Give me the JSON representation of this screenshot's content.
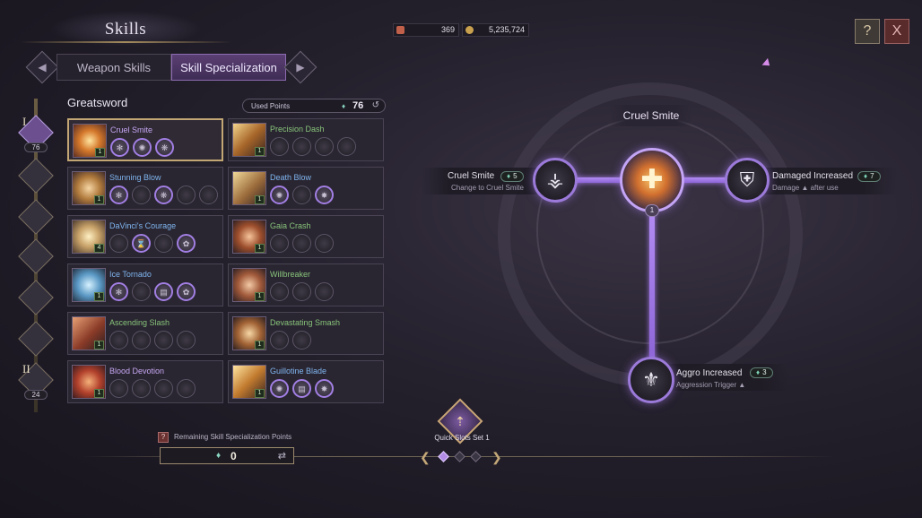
{
  "header": {
    "title": "Skills",
    "tabs": [
      {
        "label": "Weapon Skills",
        "active": false
      },
      {
        "label": "Skill Specialization",
        "active": true
      }
    ]
  },
  "currencies": [
    {
      "name": "currency-1",
      "value": "369",
      "icon_color": "#c0604a"
    },
    {
      "name": "currency-2",
      "value": "5,235,724",
      "icon_color": "#c9a14e"
    }
  ],
  "top_right": {
    "help_icon": "?",
    "close_icon": "X"
  },
  "tiers": [
    {
      "numeral": "I",
      "points": "76",
      "active": true
    },
    {
      "numeral": "",
      "points": "",
      "active": false
    },
    {
      "numeral": "",
      "points": "",
      "active": false
    },
    {
      "numeral": "",
      "points": "",
      "active": false
    },
    {
      "numeral": "",
      "points": "",
      "active": false
    },
    {
      "numeral": "",
      "points": "",
      "active": false
    },
    {
      "numeral": "II",
      "points": "24",
      "active": false
    }
  ],
  "weapon": {
    "name": "Greatsword",
    "used_points_label": "Used Points",
    "used_points_value": "76"
  },
  "skills": [
    {
      "name": "Cruel Smite",
      "color": "purple",
      "level": "1",
      "selected": true,
      "tripods": [
        "✻",
        "✺",
        "❋"
      ],
      "tripods_on": [
        true,
        true,
        true
      ]
    },
    {
      "name": "Precision Dash",
      "color": "green",
      "level": "1",
      "selected": false,
      "tripods": [
        "",
        "",
        "",
        ""
      ],
      "tripods_on": [
        false,
        false,
        false,
        false
      ]
    },
    {
      "name": "Stunning Blow",
      "color": "blue",
      "level": "1",
      "selected": false,
      "tripods": [
        "✻",
        "",
        "❋",
        "",
        ""
      ],
      "tripods_on": [
        true,
        false,
        true,
        false,
        false
      ]
    },
    {
      "name": "Death Blow",
      "color": "blue",
      "level": "1",
      "selected": false,
      "tripods": [
        "✺",
        "",
        "✸"
      ],
      "tripods_on": [
        true,
        false,
        true
      ]
    },
    {
      "name": "DaVinci's Courage",
      "color": "blue",
      "level": "4",
      "selected": false,
      "tripods": [
        "",
        "⌛",
        "",
        "✿"
      ],
      "tripods_on": [
        false,
        true,
        false,
        true
      ]
    },
    {
      "name": "Gaia Crash",
      "color": "green",
      "level": "1",
      "selected": false,
      "tripods": [
        "",
        "",
        ""
      ],
      "tripods_on": [
        false,
        false,
        false
      ]
    },
    {
      "name": "Ice Tornado",
      "color": "blue",
      "level": "1",
      "selected": false,
      "tripods": [
        "✻",
        "",
        "▤",
        "✿"
      ],
      "tripods_on": [
        true,
        false,
        true,
        true
      ]
    },
    {
      "name": "Willbreaker",
      "color": "green",
      "level": "1",
      "selected": false,
      "tripods": [
        "",
        "",
        ""
      ],
      "tripods_on": [
        false,
        false,
        false
      ]
    },
    {
      "name": "Ascending Slash",
      "color": "green",
      "level": "1",
      "selected": false,
      "tripods": [
        "",
        "",
        "",
        ""
      ],
      "tripods_on": [
        false,
        false,
        false,
        false
      ]
    },
    {
      "name": "Devastating Smash",
      "color": "green",
      "level": "1",
      "selected": false,
      "tripods": [
        "",
        ""
      ],
      "tripods_on": [
        false,
        false
      ]
    },
    {
      "name": "Blood Devotion",
      "color": "purple",
      "level": "1",
      "selected": false,
      "tripods": [
        "",
        "",
        "",
        ""
      ],
      "tripods_on": [
        false,
        false,
        false,
        false
      ]
    },
    {
      "name": "Guillotine Blade",
      "color": "blue",
      "level": "1",
      "selected": false,
      "tripods": [
        "✺",
        "▤",
        "✸"
      ],
      "tripods_on": [
        true,
        true,
        true
      ]
    }
  ],
  "remaining": {
    "label": "Remaining Skill Specialization Points",
    "value": "0"
  },
  "quick_slots": {
    "label": "Quick Slots Set 1",
    "slots_active": [
      true,
      false,
      false
    ]
  },
  "tree": {
    "center": {
      "title": "Cruel Smite",
      "level": "1"
    },
    "left": {
      "name": "Cruel Smite",
      "cost": "5",
      "sub": "Change to Cruel Smite"
    },
    "right": {
      "name": "Damaged Increased",
      "cost": "7",
      "sub": "Damage ▲ after use"
    },
    "bottom": {
      "name": "Aggro Increased",
      "cost": "3",
      "sub": "Aggression Trigger ▲"
    }
  }
}
